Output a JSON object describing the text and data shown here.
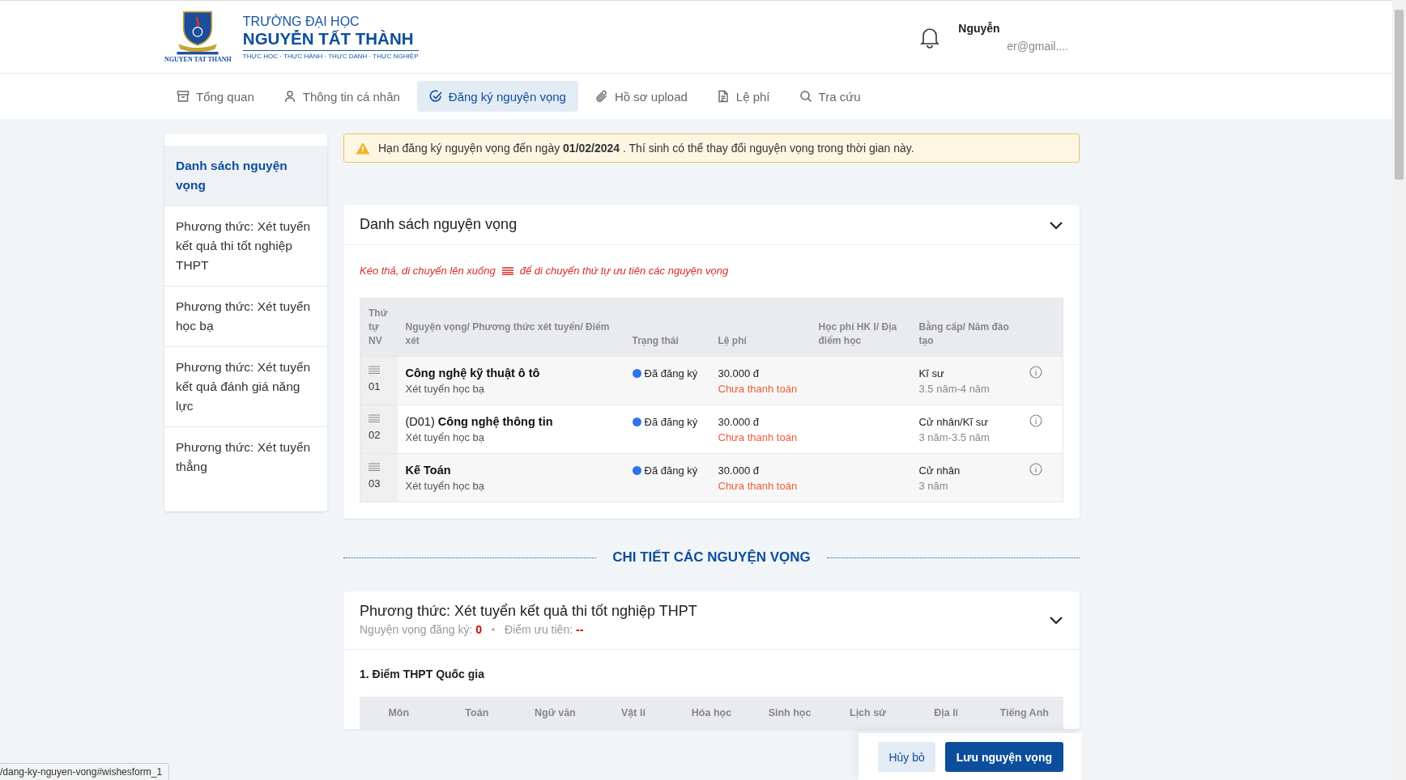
{
  "header": {
    "logo": {
      "line1": "TRƯỜNG ĐẠI HỌC",
      "line2": "NGUYỄN TẤT THÀNH",
      "slogan": "THỰC HỌC · THỰC HÀNH · THỰC DANH · THỰC NGHIỆP",
      "crest_text": "NGUYEN TAT THANH"
    },
    "user": {
      "name": "Nguyễn",
      "email": "er@gmail...."
    }
  },
  "nav": [
    {
      "label": "Tổng quan",
      "selected": false
    },
    {
      "label": "Thông tin cá nhân",
      "selected": false
    },
    {
      "label": "Đăng ký nguyện vọng",
      "selected": true
    },
    {
      "label": "Hồ sơ upload",
      "selected": false
    },
    {
      "label": "Lệ phí",
      "selected": false
    },
    {
      "label": "Tra cứu",
      "selected": false
    }
  ],
  "sidebar": {
    "items": [
      {
        "label": "Danh sách nguyện vọng",
        "selected": true
      },
      {
        "label": "Phương thức: Xét tuyển kết quả thi tốt nghiệp THPT",
        "selected": false
      },
      {
        "label": "Phương thức: Xét tuyển học bạ",
        "selected": false
      },
      {
        "label": "Phương thức: Xét tuyển kết quả đánh giá năng lực",
        "selected": false
      },
      {
        "label": "Phương thức: Xét tuyển thẳng",
        "selected": false
      }
    ]
  },
  "alert": {
    "text": "Hạn đăng ký nguyện vọng đến ngày **01/02/2024** . Thí sinh có thể thay đổi nguyện vọng trong thời gian này."
  },
  "wish_list": {
    "title": "Danh sách nguyện vọng",
    "expanded": true,
    "hint_before": "Kéo thả, di chuyển lên xuống",
    "hint_after": "để di chuyển thứ tự ưu tiên các nguyện vọng",
    "columns": [
      "Thứ tự NV",
      "Nguyện vọng/ Phương thức xét tuyển/ Điểm xét",
      "Trạng thái",
      "Lệ phí",
      "Học phí HK I/ Địa điểm học",
      "Bằng cấp/ Năm đào tạo"
    ],
    "rows": [
      {
        "order": "01",
        "name": "Công nghệ kỹ thuật ô tô",
        "method": "Xét tuyển học bạ",
        "status": "Đã đăng ký",
        "fee": "30.000 đ",
        "payment": "Chưa thanh toán",
        "degree": "Kĩ sư",
        "duration": "3.5 năm-4 năm"
      },
      {
        "order": "02",
        "code": "(D01)",
        "name": "Công nghệ thông tin",
        "method": "Xét tuyển học bạ",
        "status": "Đã đăng ký",
        "fee": "30.000 đ",
        "payment": "Chưa thanh toán",
        "degree": "Cử nhân/Kĩ sư",
        "duration": "3 năm-3.5 năm"
      },
      {
        "order": "03",
        "name": "Kế Toán",
        "method": "Xét tuyển học bạ",
        "status": "Đã đăng ký",
        "fee": "30.000 đ",
        "payment": "Chưa thanh toán",
        "degree": "Cử nhân",
        "duration": "3 năm"
      }
    ]
  },
  "section_title": "CHI TIẾT CÁC NGUYỆN VỌNG",
  "method_card": {
    "title": "Phương thức: Xét tuyển kết quả thi tốt nghiệp THPT",
    "expanded": true,
    "stats": [
      {
        "label": "Nguyện vọng đăng ký:",
        "value": "0"
      },
      {
        "label": "Điểm ưu tiên:",
        "value": "--"
      }
    ],
    "subsection": "1. Điểm THPT Quốc gia",
    "score_columns": [
      "Môn",
      "Toán",
      "Ngữ văn",
      "Vật lí",
      "Hóa học",
      "Sinh học",
      "Lịch sử",
      "Địa lí",
      "Tiếng Anh"
    ]
  },
  "actions": [
    {
      "label": "Hủy bỏ",
      "kind": "secondary"
    },
    {
      "label": "Lưu nguyện vọng",
      "kind": "primary"
    }
  ],
  "status_url": "/dang-ky-nguyen-vong#wishesform_1"
}
